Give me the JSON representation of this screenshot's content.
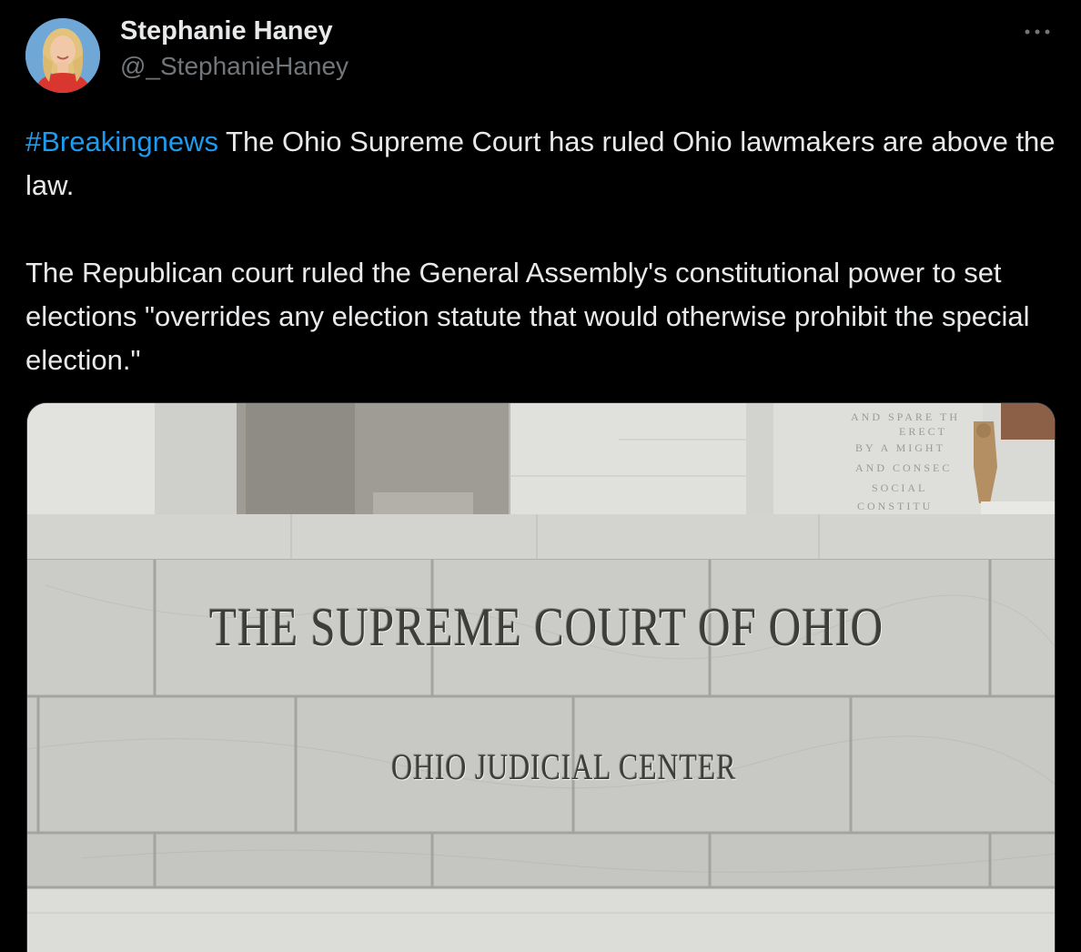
{
  "author": {
    "name": "Stephanie Haney",
    "handle": "@_StephanieHaney",
    "avatar_icon": "avatar-photo"
  },
  "menu": {
    "more_icon": "more-horizontal-icon"
  },
  "tweet": {
    "hashtag": "#Breakingnews",
    "paragraph1_rest": " The Ohio Supreme Court has ruled Ohio lawmakers are above the law.",
    "paragraph2": "The Republican court ruled the General Assembly's constitutional power to set elections \"overrides any election statute that would otherwise prohibit the special election.\""
  },
  "media": {
    "inscription_main": "THE SUPREME COURT OF OHIO",
    "inscription_sub": "OHIO JUDICIAL CENTER"
  },
  "colors": {
    "background": "#000000",
    "text": "#e7e9ea",
    "secondary_text": "#71767b",
    "link": "#1d9bf0"
  }
}
